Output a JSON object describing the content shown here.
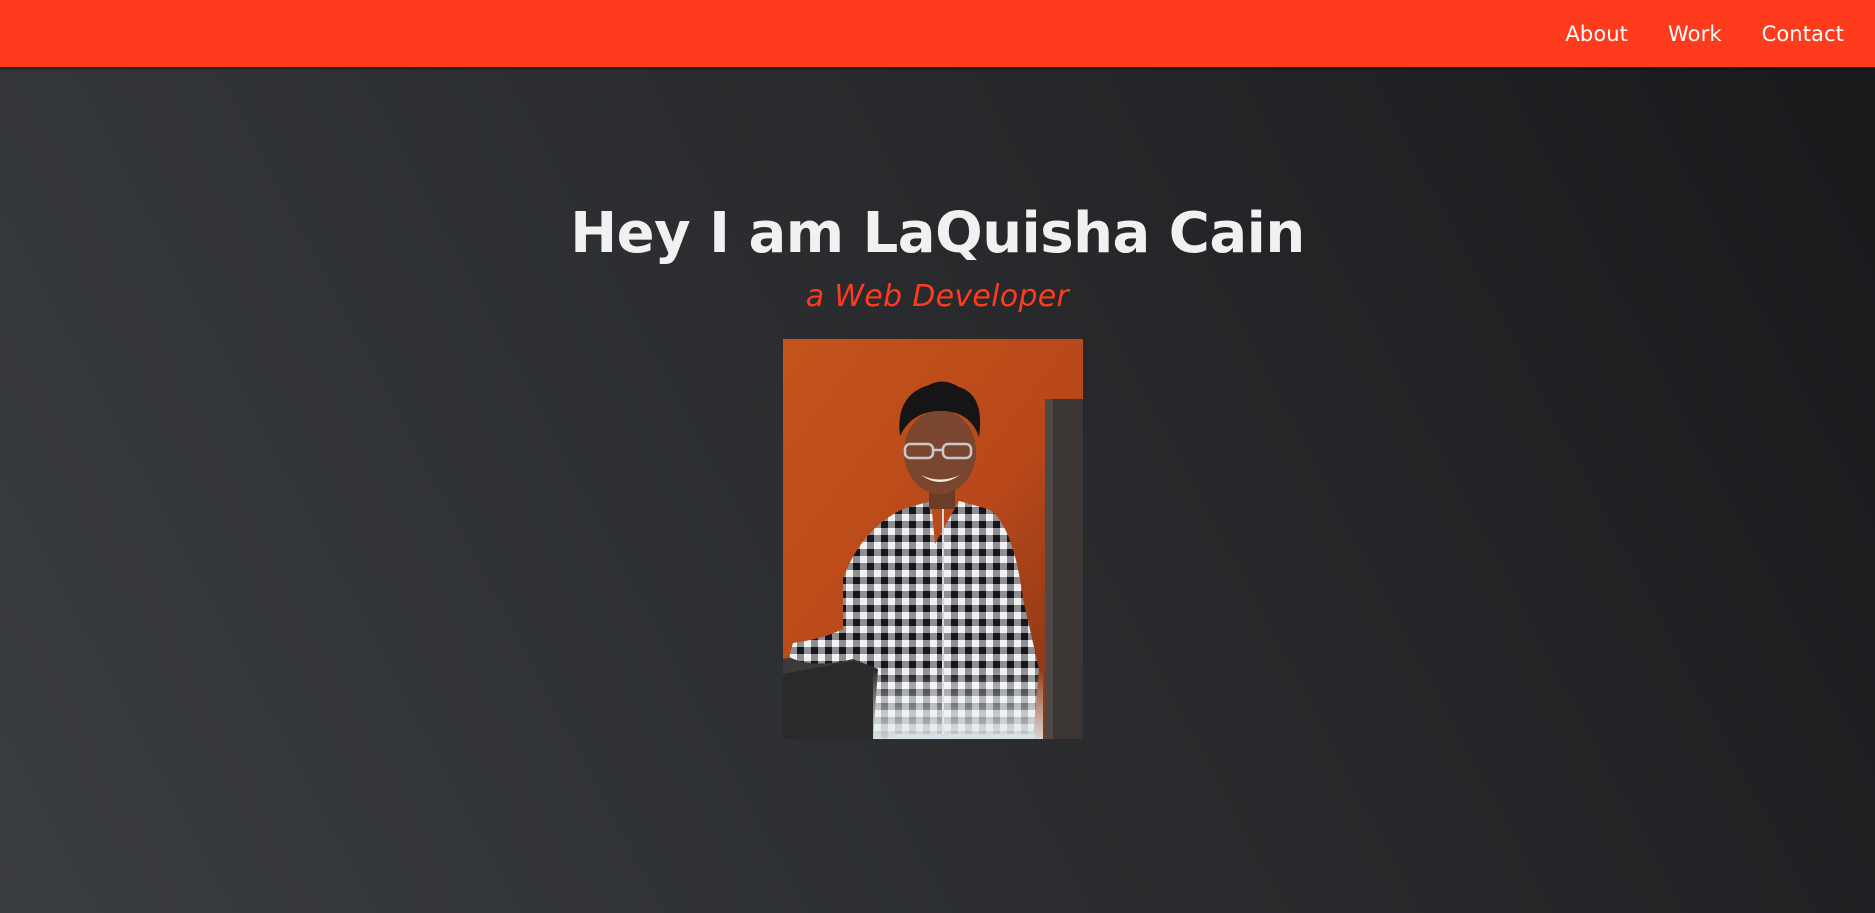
{
  "nav": {
    "items": [
      {
        "label": "About"
      },
      {
        "label": "Work"
      },
      {
        "label": "Contact"
      }
    ]
  },
  "hero": {
    "title": "Hey I am LaQuisha Cain",
    "subtitle": "a Web Developer",
    "photo_label": "profile-photo"
  },
  "colors": {
    "accent": "#ff3b1d",
    "background_dark": "#1f2023",
    "background_light": "#3a3d40",
    "title_text": "#f1f1f1"
  }
}
